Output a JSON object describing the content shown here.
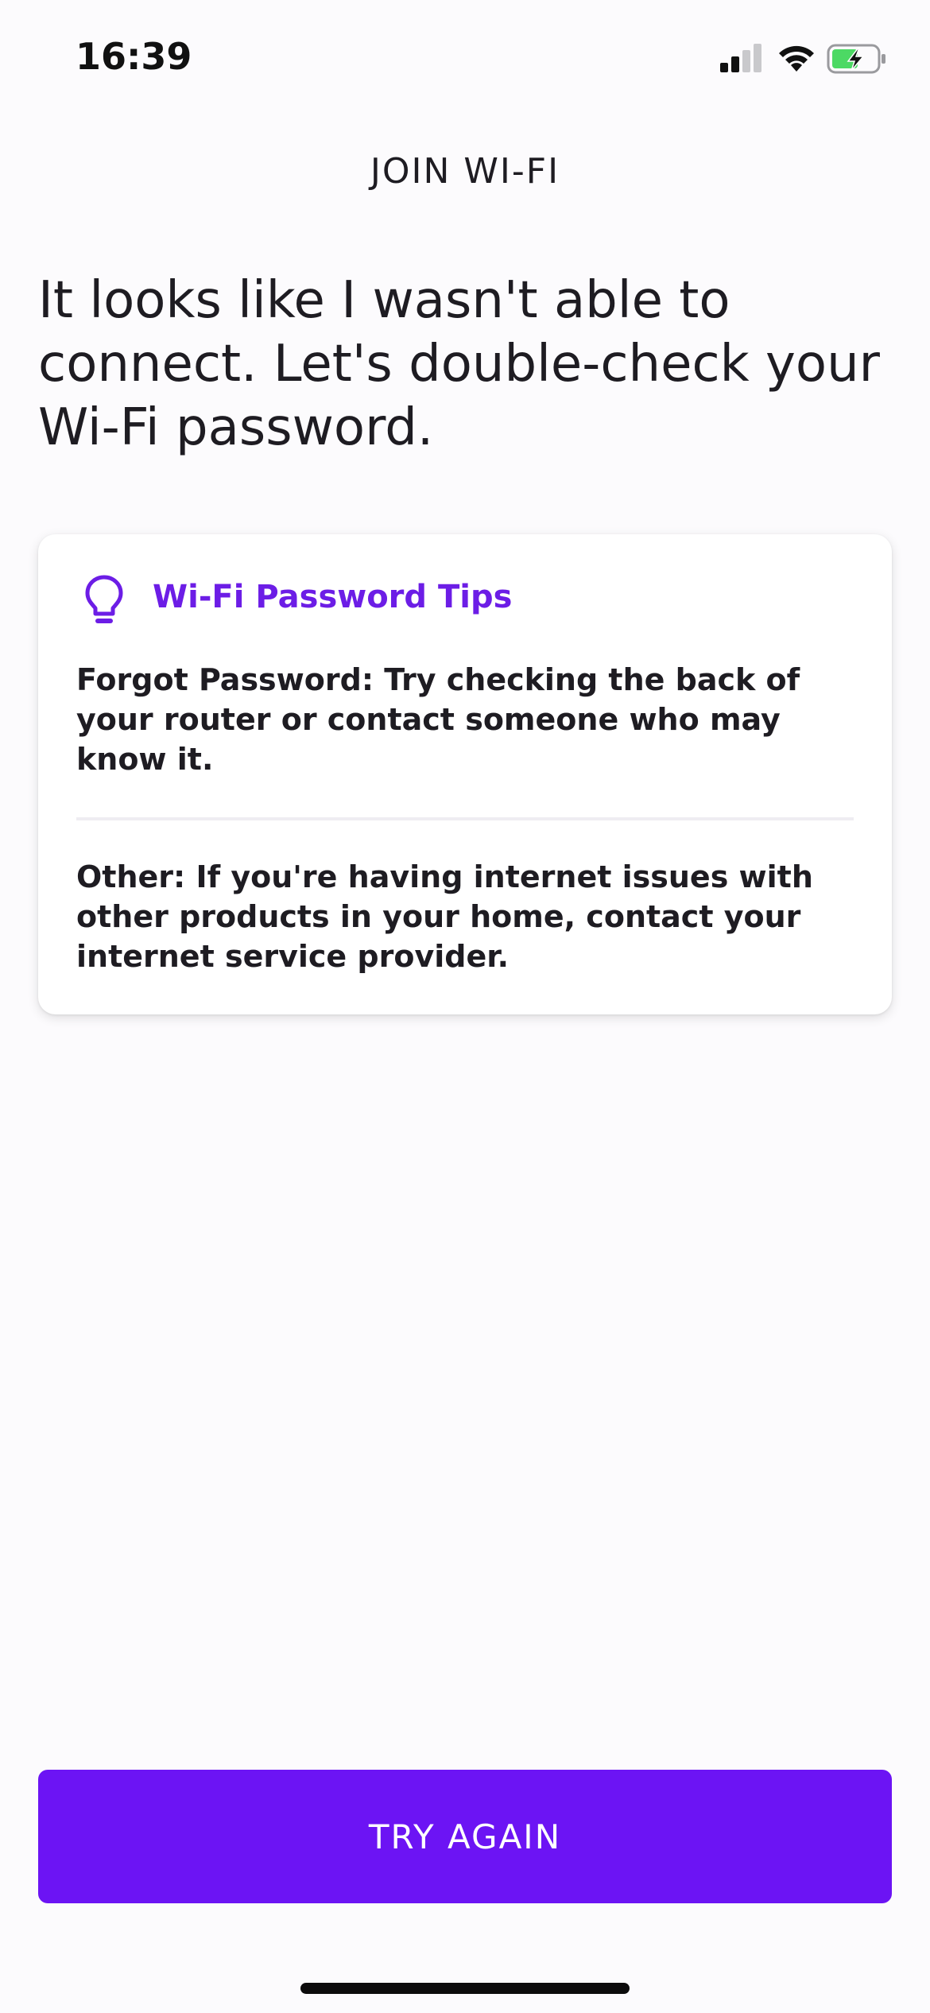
{
  "status_bar": {
    "time": "16:39",
    "icons": [
      "cellular-signal-icon",
      "wifi-icon",
      "battery-charging-icon"
    ],
    "battery_color": "#4cd964"
  },
  "header": {
    "title": "JOIN WI-FI"
  },
  "main": {
    "headline": "It looks like I wasn't able to connect. Let's double-check your Wi-Fi password."
  },
  "tips_card": {
    "icon": "lightbulb-icon",
    "title": "Wi-Fi Password Tips",
    "tips": [
      "Forgot Password: Try checking the back of your router or contact someone who may know it.",
      "Other: If you're having internet issues with other products in your home, contact your internet service provider."
    ]
  },
  "footer": {
    "try_again_label": "TRY AGAIN"
  },
  "colors": {
    "accent": "#6c14f4",
    "accent_text": "#6c1de6",
    "background": "#fcfbfd",
    "text": "#1e1c22"
  }
}
